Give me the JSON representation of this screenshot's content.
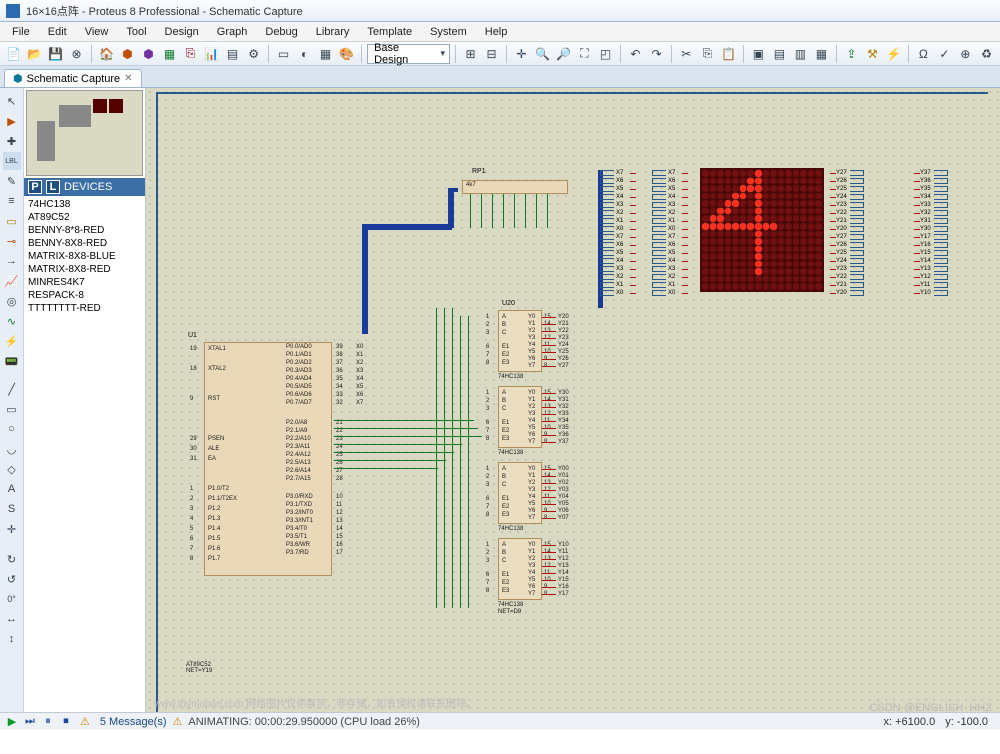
{
  "title": "16×16点阵 - Proteus 8 Professional - Schematic Capture",
  "menu": [
    "File",
    "Edit",
    "View",
    "Tool",
    "Design",
    "Graph",
    "Debug",
    "Library",
    "Template",
    "System",
    "Help"
  ],
  "toolbar_combo": "Base Design",
  "tab": {
    "label": "Schematic Capture"
  },
  "devices_header": "DEVICES",
  "devices": [
    "74HC138",
    "AT89C52",
    "BENNY-8*8-RED",
    "BENNY-8X8-RED",
    "MATRIX-8X8-BLUE",
    "MATRIX-8X8-RED",
    "MINRES4K7",
    "RESPACK-8",
    "TTTTTTTT-RED"
  ],
  "u1": {
    "name": "U1",
    "footer": "AT89C52\nNET=Y19",
    "left": [
      "XTAL1",
      "XTAL2",
      "RST",
      "PSEN",
      "ALE",
      "EA",
      "P1.0/T2",
      "P1.1/T2EX",
      "P1.2",
      "P1.3",
      "P1.4",
      "P1.5",
      "P1.6",
      "P1.7"
    ],
    "leftnum": [
      "19",
      "18",
      "9",
      "29",
      "30",
      "31",
      "1",
      "2",
      "3",
      "4",
      "5",
      "6",
      "7",
      "8"
    ],
    "right_top": [
      "P0.0/AD0",
      "P0.1/AD1",
      "P0.2/AD2",
      "P0.3/AD3",
      "P0.4/AD4",
      "P0.5/AD5",
      "P0.6/AD6",
      "P0.7/AD7"
    ],
    "right_top_num": [
      "39",
      "38",
      "37",
      "36",
      "35",
      "34",
      "33",
      "32"
    ],
    "right_top_net": [
      "X0",
      "X1",
      "X2",
      "X3",
      "X4",
      "X5",
      "X6",
      "X7"
    ],
    "right_mid": [
      "P2.0/A8",
      "P2.1/A9",
      "P2.2/A10",
      "P2.3/A11",
      "P2.4/A12",
      "P2.5/A13",
      "P2.6/A14",
      "P2.7/A15"
    ],
    "right_mid_num": [
      "21",
      "22",
      "23",
      "24",
      "25",
      "26",
      "27",
      "28"
    ],
    "right_bot": [
      "P3.0/RXD",
      "P3.1/TXD",
      "P3.2/INT0",
      "P3.3/INT1",
      "P3.4/T0",
      "P3.5/T1",
      "P3.6/WR",
      "P3.7/RD"
    ],
    "right_bot_num": [
      "10",
      "11",
      "12",
      "13",
      "14",
      "15",
      "16",
      "17"
    ]
  },
  "hc138": {
    "u20": "U20",
    "pins_l": [
      "A",
      "B",
      "C",
      "E1",
      "E2",
      "E3"
    ],
    "pins_r": [
      "Y0",
      "Y1",
      "Y2",
      "Y3",
      "Y4",
      "Y5",
      "Y6",
      "Y7"
    ],
    "footer": "74HC138",
    "netd9": "NET=D9"
  },
  "hc_nets": [
    [
      "Y20",
      "Y21",
      "Y22",
      "Y23",
      "Y24",
      "Y25",
      "Y26",
      "Y27"
    ],
    [
      "Y30",
      "Y31",
      "Y32",
      "Y33",
      "Y34",
      "Y35",
      "Y36",
      "Y37"
    ],
    [
      "Y00",
      "Y01",
      "Y02",
      "Y03",
      "Y04",
      "Y05",
      "Y06",
      "Y07"
    ],
    [
      "Y10",
      "Y11",
      "Y12",
      "Y13",
      "Y14",
      "Y15",
      "Y16",
      "Y17"
    ]
  ],
  "rp1": "RP1",
  "rp1v": "4k7",
  "x_labels_a": [
    "X7",
    "X6",
    "X5",
    "X4",
    "X3",
    "X2",
    "X1",
    "X0",
    "X7",
    "X6",
    "X5",
    "X4",
    "X3",
    "X2",
    "X1",
    "X0"
  ],
  "x_labels_b": [
    "X7",
    "X6",
    "X5",
    "X4",
    "X3",
    "X2",
    "X1",
    "X0",
    "X7",
    "X6",
    "X5",
    "X4",
    "X3",
    "X2",
    "X1",
    "X0"
  ],
  "y_labels_a": [
    "Y27",
    "Y26",
    "Y25",
    "Y24",
    "Y23",
    "Y22",
    "Y21",
    "Y20",
    "Y27",
    "Y26",
    "Y25",
    "Y24",
    "Y23",
    "Y22",
    "Y21",
    "Y20"
  ],
  "y_labels_b": [
    "Y37",
    "Y36",
    "Y35",
    "Y34",
    "Y33",
    "Y32",
    "Y31",
    "Y30",
    "Y17",
    "Y16",
    "Y15",
    "Y14",
    "Y13",
    "Y12",
    "Y11",
    "Y10"
  ],
  "led_pattern": [
    [
      0,
      0,
      0,
      0,
      0,
      0,
      0,
      1,
      0,
      0,
      0,
      0,
      0,
      0,
      0,
      0
    ],
    [
      0,
      0,
      0,
      0,
      0,
      0,
      1,
      1,
      0,
      0,
      0,
      0,
      0,
      0,
      0,
      0
    ],
    [
      0,
      0,
      0,
      0,
      0,
      1,
      1,
      1,
      0,
      0,
      0,
      0,
      0,
      0,
      0,
      0
    ],
    [
      0,
      0,
      0,
      0,
      1,
      1,
      0,
      1,
      0,
      0,
      0,
      0,
      0,
      0,
      0,
      0
    ],
    [
      0,
      0,
      0,
      1,
      1,
      0,
      0,
      1,
      0,
      0,
      0,
      0,
      0,
      0,
      0,
      0
    ],
    [
      0,
      0,
      1,
      1,
      0,
      0,
      0,
      1,
      0,
      0,
      0,
      0,
      0,
      0,
      0,
      0
    ],
    [
      0,
      1,
      1,
      0,
      0,
      0,
      0,
      1,
      0,
      0,
      0,
      0,
      0,
      0,
      0,
      0
    ],
    [
      1,
      1,
      1,
      1,
      1,
      1,
      1,
      1,
      1,
      1,
      0,
      0,
      0,
      0,
      0,
      0
    ],
    [
      0,
      0,
      0,
      0,
      0,
      0,
      0,
      1,
      0,
      0,
      0,
      0,
      0,
      0,
      0,
      0
    ],
    [
      0,
      0,
      0,
      0,
      0,
      0,
      0,
      1,
      0,
      0,
      0,
      0,
      0,
      0,
      0,
      0
    ],
    [
      0,
      0,
      0,
      0,
      0,
      0,
      0,
      1,
      0,
      0,
      0,
      0,
      0,
      0,
      0,
      0
    ],
    [
      0,
      0,
      0,
      0,
      0,
      0,
      0,
      1,
      0,
      0,
      0,
      0,
      0,
      0,
      0,
      0
    ],
    [
      0,
      0,
      0,
      0,
      0,
      0,
      0,
      1,
      0,
      0,
      0,
      0,
      0,
      0,
      0,
      0
    ],
    [
      0,
      0,
      0,
      0,
      0,
      0,
      0,
      1,
      0,
      0,
      0,
      0,
      0,
      0,
      0,
      0
    ],
    [
      0,
      0,
      0,
      0,
      0,
      0,
      0,
      0,
      0,
      0,
      0,
      0,
      0,
      0,
      0,
      0
    ],
    [
      0,
      0,
      0,
      0,
      0,
      0,
      0,
      0,
      0,
      0,
      0,
      0,
      0,
      0,
      0,
      0
    ]
  ],
  "status": {
    "messages": "5 Message(s)",
    "anim": "ANIMATING: 00:00:29.950000 (CPU load 26%)",
    "x": "x: +6100.0",
    "y": "y: -100.0"
  },
  "watermark": "www.tdymoban.com 网络图片仅供展示，非存储，如有侵权请联系删除。",
  "watermark2": "CSDN @ENGLISH_HHZ"
}
